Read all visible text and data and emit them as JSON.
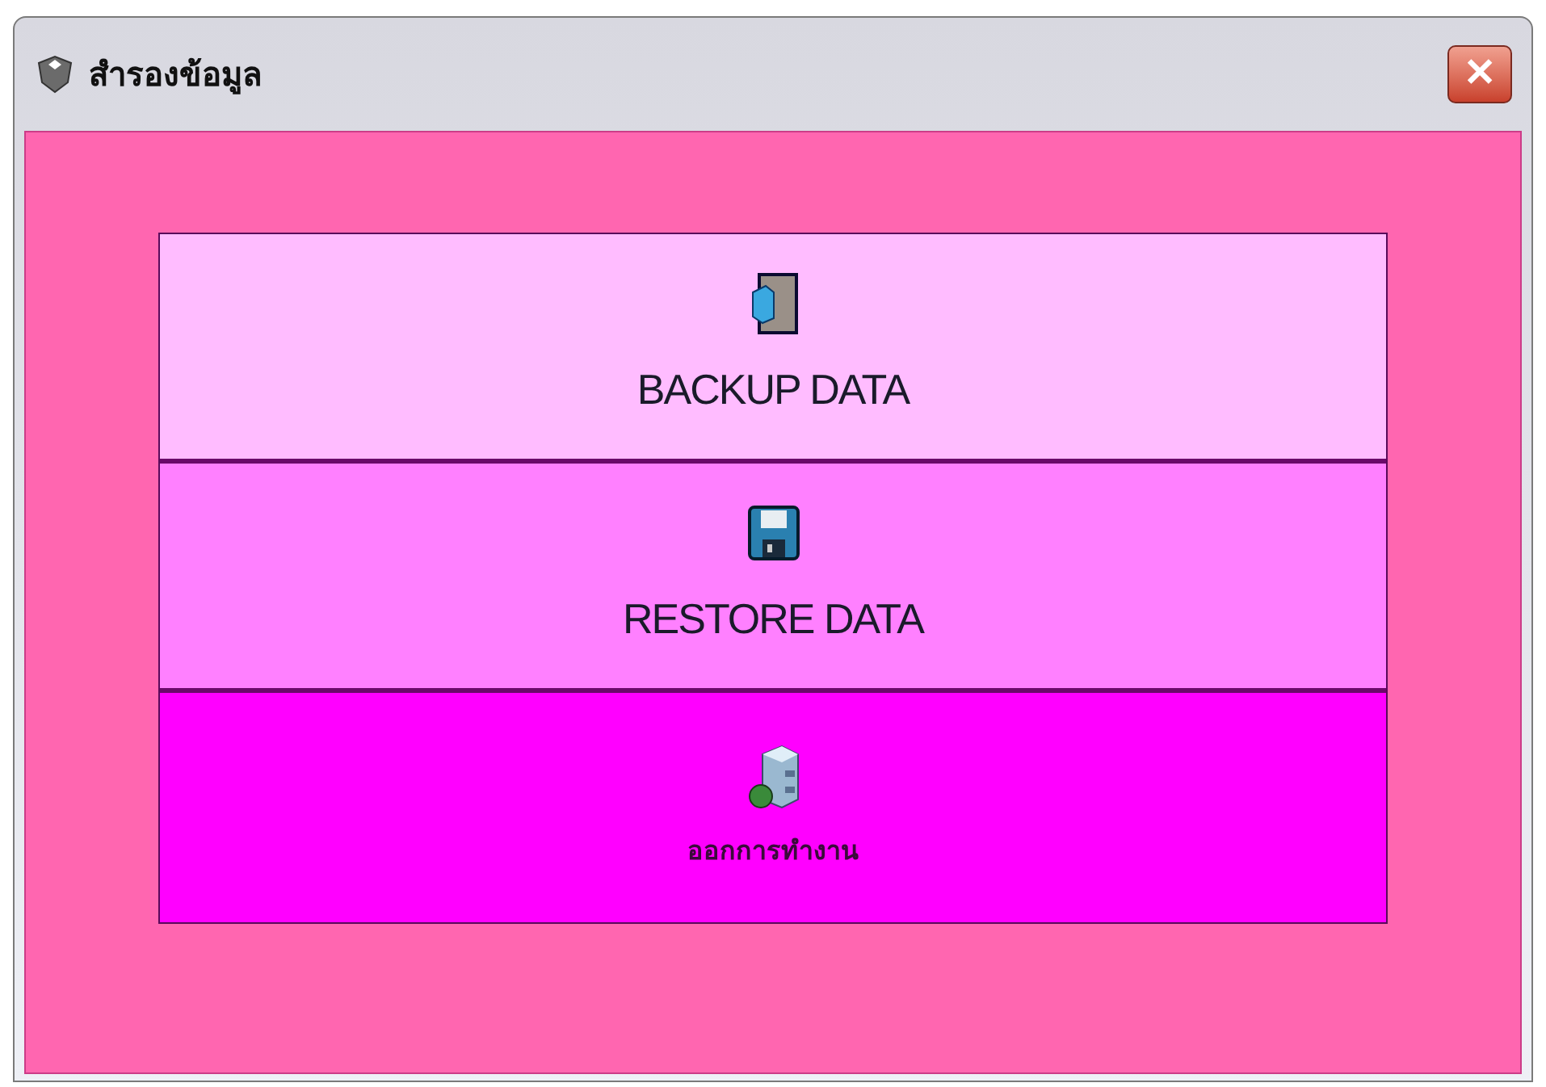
{
  "window": {
    "title": "สำรองข้อมูล",
    "close": "✕"
  },
  "buttons": [
    {
      "kind": "backup",
      "label": "BACKUP DATA",
      "color": "#ffbcff"
    },
    {
      "kind": "restore",
      "label": "RESTORE DATA",
      "color": "#ff80ff"
    },
    {
      "kind": "exit",
      "label": "ออกการทำงาน",
      "color": "#ff00ff"
    }
  ]
}
